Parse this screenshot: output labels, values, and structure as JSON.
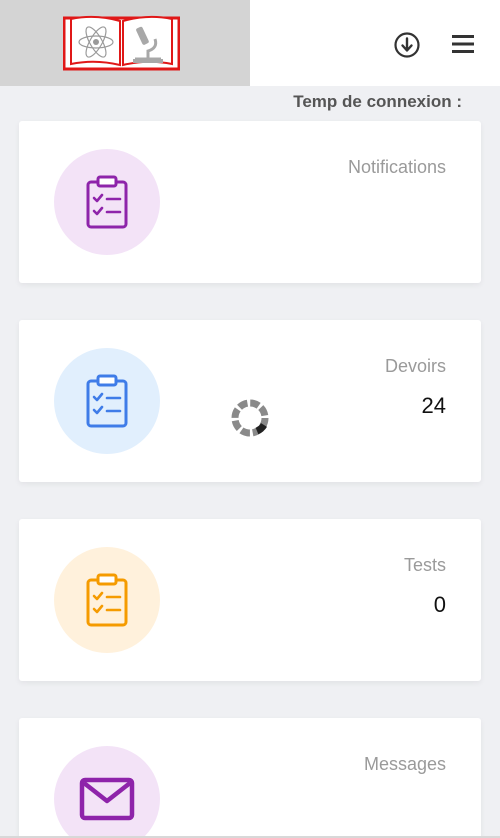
{
  "header": {
    "logo_icon": "open-book-science-logo-icon",
    "download_icon": "download-circle-icon",
    "menu_icon": "hamburger-menu-icon"
  },
  "connection": {
    "label": "Temp de connexion :"
  },
  "cards": [
    {
      "title": "Notifications",
      "count": "",
      "icon": "clipboard-checklist-icon",
      "icon_color": "#8e24aa",
      "circle_color": "#f3e3f7"
    },
    {
      "title": "Devoirs",
      "count": "24",
      "icon": "clipboard-checklist-icon",
      "icon_color": "#3f7ce8",
      "circle_color": "#e1effd"
    },
    {
      "title": "Tests",
      "count": "0",
      "icon": "clipboard-checklist-icon",
      "icon_color": "#f59b00",
      "circle_color": "#fff1dc"
    },
    {
      "title": "Messages",
      "count": "",
      "icon": "envelope-icon",
      "icon_color": "#8e24aa",
      "circle_color": "#f3e3f7"
    }
  ],
  "loading_indicator": "loading-spinner-icon"
}
